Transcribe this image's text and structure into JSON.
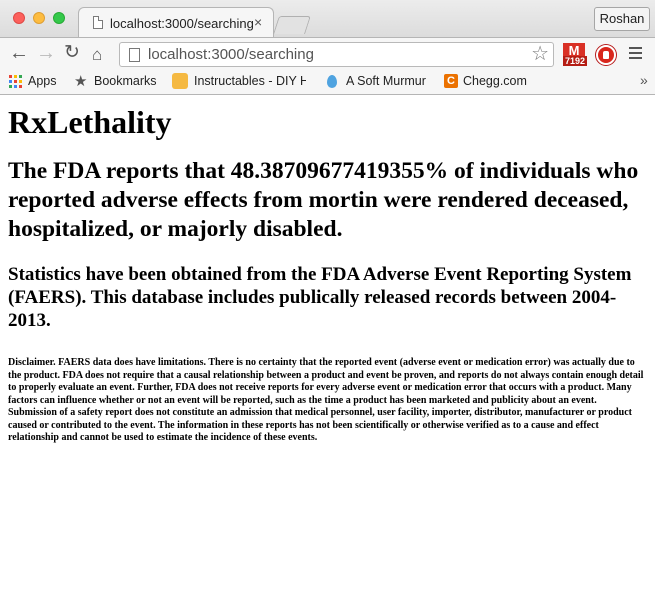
{
  "browser": {
    "tab_title": "localhost:3000/searching",
    "tab_close": "×",
    "profile_name": "Roshan",
    "url": "localhost:3000/searching",
    "gmail_count": "7192",
    "gmail_letter": "M",
    "nav": {
      "back": "←",
      "forward": "→",
      "reload": "↻",
      "home": "⌂",
      "star": "☆"
    },
    "bookmarks": {
      "items": [
        {
          "label": "Apps",
          "icon": "apps-grid-icon"
        },
        {
          "label": "Bookmarks",
          "icon": "star-icon"
        },
        {
          "label": "Instructables - DIY H",
          "icon": "instructables-icon"
        },
        {
          "label": "A Soft Murmur",
          "icon": "water-drop-icon"
        },
        {
          "label": "Chegg.com",
          "icon": "chegg-icon"
        }
      ],
      "more": "»",
      "chegg_letter": "C"
    },
    "colors": {
      "traffic_red": "#fc605c",
      "traffic_yellow": "#fdbc40",
      "traffic_green": "#34c84a",
      "gmail_red": "#d93025",
      "stop_red": "#d9261c",
      "chegg_orange": "#eb7100"
    }
  },
  "page": {
    "title": "RxLethality",
    "headline": "The FDA reports that 48.38709677419355% of individuals who reported adverse effects from mortin were rendered deceased, hospitalized, or majorly disabled.",
    "subhead": "Statistics have been obtained from the FDA Adverse Event Reporting System (FAERS). This database includes publically released records between 2004-2013.",
    "disclaimer": "Disclaimer. FAERS data does have limitations. There is no certainty that the reported event (adverse event or medication error) was actually due to the product. FDA does not require that a causal relationship between a product and event be proven, and reports do not always contain enough detail to properly evaluate an event. Further, FDA does not receive reports for every adverse event or medication error that occurs with a product. Many factors can influence whether or not an event will be reported, such as the time a product has been marketed and publicity about an event. Submission of a safety report does not constitute an admission that medical personnel, user facility, importer, distributor, manufacturer or product caused or contributed to the event. The information in these reports has not been scientifically or otherwise verified as to a cause and effect relationship and cannot be used to estimate the incidence of these events."
  }
}
